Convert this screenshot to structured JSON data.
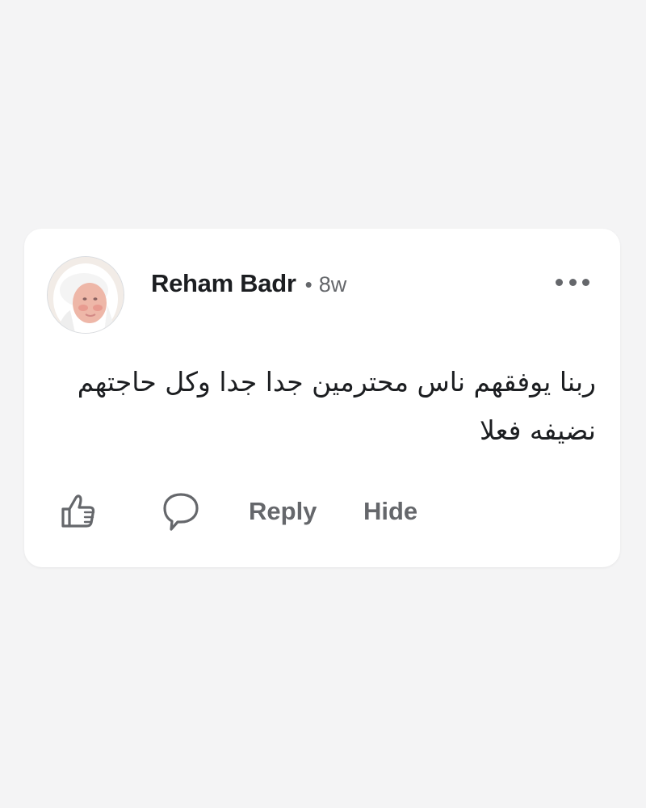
{
  "comment": {
    "author": "Reham Badr",
    "separator": "•",
    "time": "8w",
    "text": "ربنا يوفقهم ناس محترمين جدا جدا وكل حاجتهم نضيفه فعلا",
    "direction": "rtl"
  },
  "actions": {
    "reply_label": "Reply",
    "hide_label": "Hide"
  },
  "icons": {
    "avatar": "profile-photo",
    "more": "more-options-dots",
    "like": "thumbs-up-outline",
    "comment": "speech-bubble-outline"
  },
  "colors": {
    "background": "#f4f4f5",
    "card": "#ffffff",
    "text_primary": "#1c1e21",
    "text_secondary": "#65676b"
  }
}
